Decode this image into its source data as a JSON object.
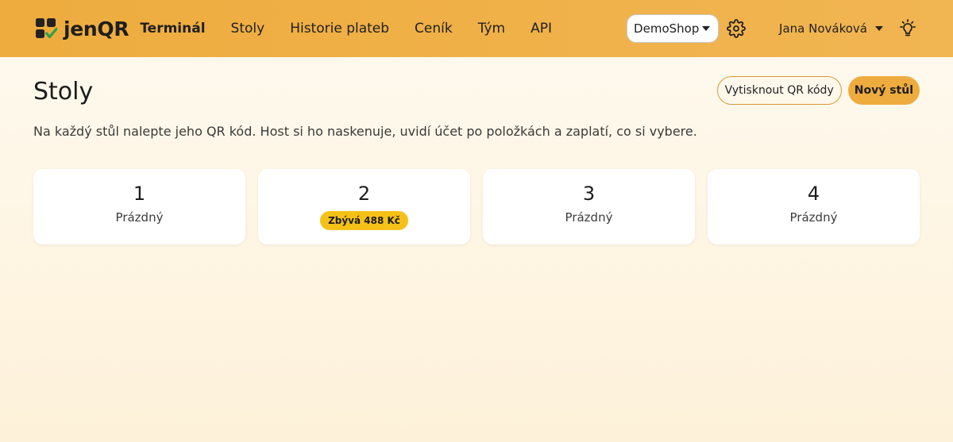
{
  "brand": {
    "name": "jenQR"
  },
  "nav": {
    "items": [
      {
        "label": "Terminál",
        "active": true
      },
      {
        "label": "Stoly",
        "active": false
      },
      {
        "label": "Historie plateb",
        "active": false
      },
      {
        "label": "Ceník",
        "active": false
      },
      {
        "label": "Tým",
        "active": false
      },
      {
        "label": "API",
        "active": false
      }
    ]
  },
  "header_right": {
    "shop": "DemoShop",
    "user": "Jana Nováková",
    "icons": [
      "gear-icon",
      "lightbulb-icon"
    ]
  },
  "page": {
    "title": "Stoly",
    "subtitle": "Na každý stůl nalepte jeho QR kód. Host si ho naskenuje, uvidí účet po položkách a zaplatí, co si vybere.",
    "print_button": "Vytisknout QR kódy",
    "new_button": "Nový stůl"
  },
  "tables": [
    {
      "number": "1",
      "status": "Prázdný",
      "badge": false
    },
    {
      "number": "2",
      "status": "Zbývá 488 Kč",
      "badge": true
    },
    {
      "number": "3",
      "status": "Prázdný",
      "badge": false
    },
    {
      "number": "4",
      "status": "Prázdný",
      "badge": false
    }
  ],
  "colors": {
    "accent": "#eeac3e",
    "badge": "#f5c118",
    "logo_dark": "#222222",
    "logo_check": "#2e9e4a"
  }
}
